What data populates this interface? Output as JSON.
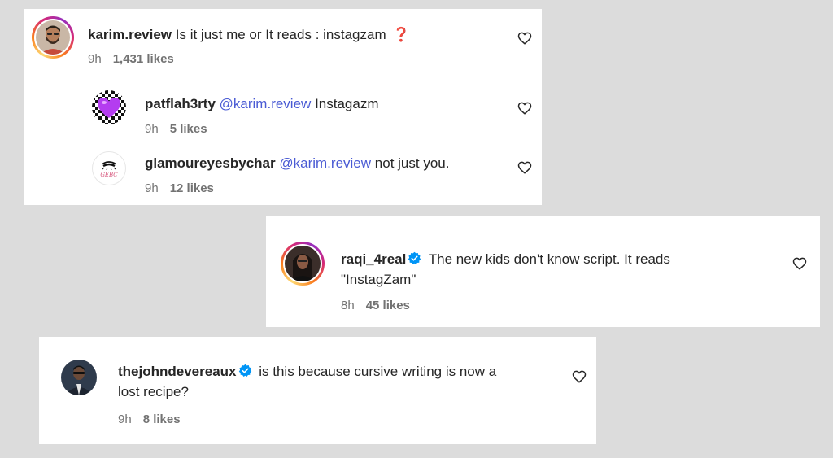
{
  "comments": [
    {
      "username": "karim.review",
      "text": "Is it just me or It reads : instagzam",
      "emoji": "❓",
      "time": "9h",
      "likes": "1,431 likes",
      "avatar": "photo-avatar-man"
    },
    {
      "username": "patflah3rty",
      "mention": "@karim.review",
      "text": "Instagazm",
      "time": "9h",
      "likes": "5 likes",
      "avatar": "checkered-purple-heart-avatar"
    },
    {
      "username": "glamoureyesbychar",
      "mention": "@karim.review",
      "text": "not just you.",
      "time": "9h",
      "likes": "12 likes",
      "avatar": "gebc-eye-logo-avatar",
      "logo_text": "GEBC"
    },
    {
      "username": "raqi_4real",
      "text": "The new kids don't know script. It reads",
      "text_line2": "\"InstagZam\"",
      "time": "8h",
      "likes": "45 likes",
      "avatar": "photo-avatar-woman",
      "verified": true
    },
    {
      "username": "thejohndevereaux",
      "text": "is this because cursive writing is now a",
      "text_line2": "lost recipe?",
      "time": "9h",
      "likes": "8 likes",
      "avatar": "photo-avatar-man-suit",
      "verified": true
    }
  ],
  "icons": {
    "like": "heart-outline-icon",
    "verified": "verified-badge-icon"
  },
  "colors": {
    "background": "#dcdcdc",
    "card": "#ffffff",
    "mention": "#4a5bd4",
    "verified": "#0095f6",
    "meta": "#737373"
  }
}
